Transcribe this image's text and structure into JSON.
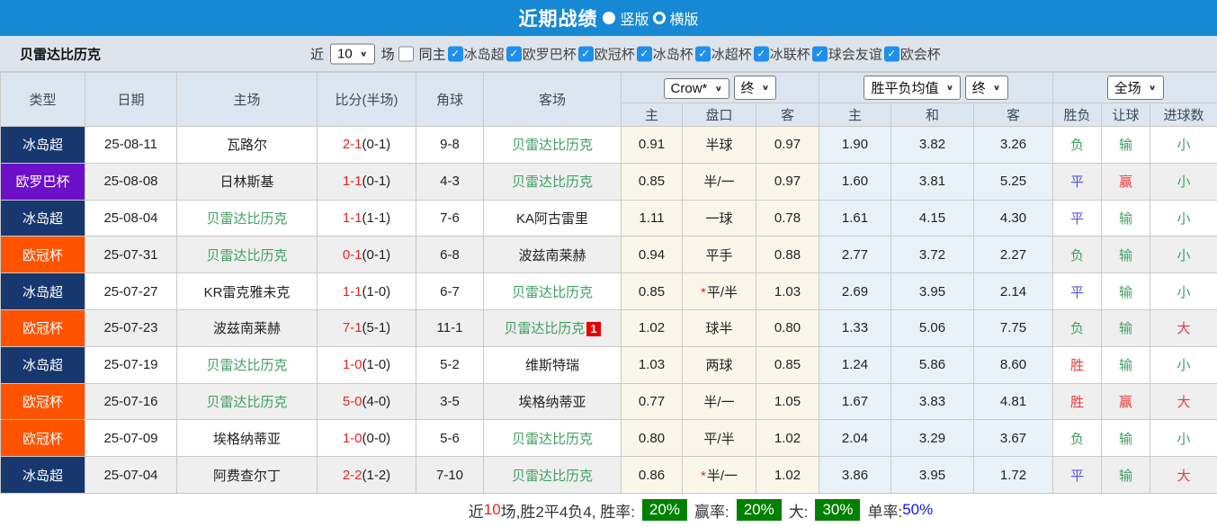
{
  "title_bar": {
    "title": "近期战绩",
    "vertical_label": "竖版",
    "horizontal_label": "横版",
    "selected": "竖版"
  },
  "filter_bar": {
    "team": "贝雷达比历克",
    "near_label": "近",
    "matches_count": "10",
    "matches_label": "场",
    "same_home_label": "同主",
    "same_home_checked": false,
    "leagues": [
      "冰岛超",
      "欧罗巴杯",
      "欧冠杯",
      "冰岛杯",
      "冰超杯",
      "冰联杯",
      "球会友谊",
      "欧会杯"
    ]
  },
  "table": {
    "left_headers": [
      "类型",
      "日期",
      "主场",
      "比分(半场)",
      "角球",
      "客场"
    ],
    "odds_group": {
      "company_select": "Crow*",
      "time_select": "终",
      "columns": [
        "主",
        "盘口",
        "客"
      ]
    },
    "avg_group": {
      "type_select": "胜平负均值",
      "time_select": "终",
      "columns": [
        "主",
        "和",
        "客"
      ]
    },
    "result_group": {
      "period_select": "全场",
      "columns": [
        "胜负",
        "让球",
        "进球数"
      ]
    },
    "type_colors": {
      "冰岛超": "#16386e",
      "欧罗巴杯": "#6c0fc8",
      "欧冠杯": "#ff5300"
    },
    "result_colors": {
      "胜": "#e63b3b",
      "平": "#5353e6",
      "负": "#3f9e63",
      "赢": "#e63b3b",
      "输": "#3f9e63",
      "大": "#e63b3b",
      "小": "#3f9e63"
    },
    "focus_team_color": "#3f9e63",
    "rows": [
      {
        "type": "冰岛超",
        "date": "25-08-11",
        "home": "瓦路尔",
        "home_focus": false,
        "score": "2-1",
        "half": "(0-1)",
        "corner": "9-8",
        "away": "贝雷达比历克",
        "away_focus": true,
        "away_card": "",
        "asian": [
          "0.91",
          "半球",
          "0.97"
        ],
        "asian_star": false,
        "avg": [
          "1.90",
          "3.82",
          "3.26"
        ],
        "results": [
          "负",
          "输",
          "小"
        ]
      },
      {
        "type": "欧罗巴杯",
        "date": "25-08-08",
        "home": "日林斯基",
        "home_focus": false,
        "score": "1-1",
        "half": "(0-1)",
        "corner": "4-3",
        "away": "贝雷达比历克",
        "away_focus": true,
        "away_card": "",
        "asian": [
          "0.85",
          "半/一",
          "0.97"
        ],
        "asian_star": false,
        "avg": [
          "1.60",
          "3.81",
          "5.25"
        ],
        "results": [
          "平",
          "赢",
          "小"
        ]
      },
      {
        "type": "冰岛超",
        "date": "25-08-04",
        "home": "贝雷达比历克",
        "home_focus": true,
        "score": "1-1",
        "half": "(1-1)",
        "corner": "7-6",
        "away": "KA阿古雷里",
        "away_focus": false,
        "away_card": "",
        "asian": [
          "1.11",
          "一球",
          "0.78"
        ],
        "asian_star": false,
        "avg": [
          "1.61",
          "4.15",
          "4.30"
        ],
        "results": [
          "平",
          "输",
          "小"
        ]
      },
      {
        "type": "欧冠杯",
        "date": "25-07-31",
        "home": "贝雷达比历克",
        "home_focus": true,
        "score": "0-1",
        "half": "(0-1)",
        "corner": "6-8",
        "away": "波兹南莱赫",
        "away_focus": false,
        "away_card": "",
        "asian": [
          "0.94",
          "平手",
          "0.88"
        ],
        "asian_star": false,
        "avg": [
          "2.77",
          "3.72",
          "2.27"
        ],
        "results": [
          "负",
          "输",
          "小"
        ]
      },
      {
        "type": "冰岛超",
        "date": "25-07-27",
        "home": "KR雷克雅未克",
        "home_focus": false,
        "score": "1-1",
        "half": "(1-0)",
        "corner": "6-7",
        "away": "贝雷达比历克",
        "away_focus": true,
        "away_card": "",
        "asian": [
          "0.85",
          "平/半",
          "1.03"
        ],
        "asian_star": true,
        "avg": [
          "2.69",
          "3.95",
          "2.14"
        ],
        "results": [
          "平",
          "输",
          "小"
        ]
      },
      {
        "type": "欧冠杯",
        "date": "25-07-23",
        "home": "波兹南莱赫",
        "home_focus": false,
        "score": "7-1",
        "half": "(5-1)",
        "corner": "11-1",
        "away": "贝雷达比历克",
        "away_focus": true,
        "away_card": "1",
        "asian": [
          "1.02",
          "球半",
          "0.80"
        ],
        "asian_star": false,
        "avg": [
          "1.33",
          "5.06",
          "7.75"
        ],
        "results": [
          "负",
          "输",
          "大"
        ]
      },
      {
        "type": "冰岛超",
        "date": "25-07-19",
        "home": "贝雷达比历克",
        "home_focus": true,
        "score": "1-0",
        "half": "(1-0)",
        "corner": "5-2",
        "away": "维斯特瑞",
        "away_focus": false,
        "away_card": "",
        "asian": [
          "1.03",
          "两球",
          "0.85"
        ],
        "asian_star": false,
        "avg": [
          "1.24",
          "5.86",
          "8.60"
        ],
        "results": [
          "胜",
          "输",
          "小"
        ]
      },
      {
        "type": "欧冠杯",
        "date": "25-07-16",
        "home": "贝雷达比历克",
        "home_focus": true,
        "score": "5-0",
        "half": "(4-0)",
        "corner": "3-5",
        "away": "埃格纳蒂亚",
        "away_focus": false,
        "away_card": "",
        "asian": [
          "0.77",
          "半/一",
          "1.05"
        ],
        "asian_star": false,
        "avg": [
          "1.67",
          "3.83",
          "4.81"
        ],
        "results": [
          "胜",
          "赢",
          "大"
        ]
      },
      {
        "type": "欧冠杯",
        "date": "25-07-09",
        "home": "埃格纳蒂亚",
        "home_focus": false,
        "score": "1-0",
        "half": "(0-0)",
        "corner": "5-6",
        "away": "贝雷达比历克",
        "away_focus": true,
        "away_card": "",
        "asian": [
          "0.80",
          "平/半",
          "1.02"
        ],
        "asian_star": false,
        "avg": [
          "2.04",
          "3.29",
          "3.67"
        ],
        "results": [
          "负",
          "输",
          "小"
        ]
      },
      {
        "type": "冰岛超",
        "date": "25-07-04",
        "home": "阿费查尔丁",
        "home_focus": false,
        "score": "2-2",
        "half": "(1-2)",
        "corner": "7-10",
        "away": "贝雷达比历克",
        "away_focus": true,
        "away_card": "",
        "asian": [
          "0.86",
          "半/一",
          "1.02"
        ],
        "asian_star": true,
        "avg": [
          "3.86",
          "3.95",
          "1.72"
        ],
        "results": [
          "平",
          "输",
          "大"
        ]
      }
    ]
  },
  "summary": {
    "near_label": "近",
    "count": "10",
    "stats_text": "场,胜2平4负4, 胜率:",
    "win_rate": "20%",
    "odds_win_label": "赢率:",
    "odds_win_rate": "20%",
    "big_label": "大:",
    "big_rate": "30%",
    "single_label": "单率:",
    "single_rate": "50%",
    "badge_color": "#008000"
  }
}
